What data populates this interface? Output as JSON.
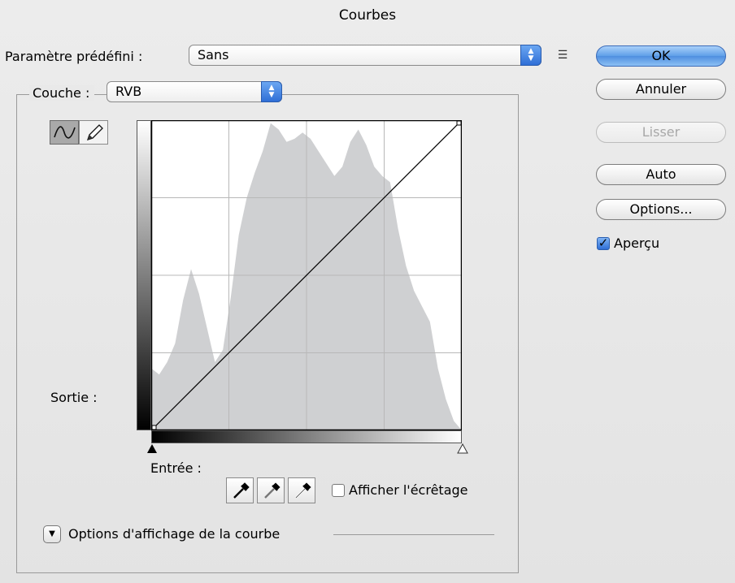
{
  "window": {
    "title": "Courbes"
  },
  "preset": {
    "label": "Paramètre prédéfini :",
    "value": "Sans"
  },
  "channel": {
    "label": "Couche :",
    "value": "RVB"
  },
  "buttons": {
    "ok": "OK",
    "cancel": "Annuler",
    "smooth": "Lisser",
    "auto": "Auto",
    "options": "Options..."
  },
  "preview": {
    "label": "Aperçu",
    "checked": true
  },
  "graph": {
    "output_label": "Sortie :",
    "input_label": "Entrée :",
    "curve_points": [
      [
        0,
        0
      ],
      [
        255,
        255
      ]
    ],
    "histogram": [
      0.2,
      0.18,
      0.22,
      0.28,
      0.42,
      0.52,
      0.44,
      0.33,
      0.22,
      0.26,
      0.43,
      0.63,
      0.75,
      0.83,
      0.9,
      0.99,
      0.97,
      0.93,
      0.94,
      0.96,
      0.94,
      0.9,
      0.86,
      0.82,
      0.85,
      0.93,
      0.97,
      0.92,
      0.85,
      0.82,
      0.8,
      0.65,
      0.53,
      0.45,
      0.4,
      0.35,
      0.2,
      0.1,
      0.03,
      0.0
    ]
  },
  "clipping": {
    "label": "Afficher l'écrêtage",
    "checked": false
  },
  "curve_display": {
    "label": "Options d'affichage de la courbe"
  },
  "icons": {
    "curve_tool": "curve-tool-icon",
    "pencil_tool": "pencil-tool-icon",
    "black_eyedropper": "black-eyedropper-icon",
    "gray_eyedropper": "gray-eyedropper-icon",
    "white_eyedropper": "white-eyedropper-icon"
  }
}
